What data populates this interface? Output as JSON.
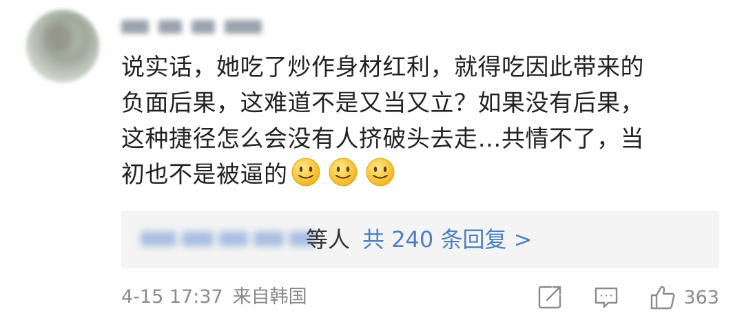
{
  "comment": {
    "text": "说实话，她吃了炒作身材红利，就得吃因此带来的\n负面后果，这难道不是又当又立？如果没有后果，\n这种捷径怎么会没有人挤破头去走…共情不了，当\n初也不是被逼的",
    "emoji_count": 3
  },
  "replies": {
    "suffix": "等人",
    "link": "共 240 条回复 >"
  },
  "footer": {
    "time": "4-15 17:37",
    "location": "来自韩国",
    "likes": "363"
  },
  "icons": {
    "share": "share-icon",
    "comment": "comment-icon",
    "like": "thumbs-up-icon"
  },
  "colors": {
    "text": "#222222",
    "muted": "#8a8a8a",
    "link": "#4a7fc3",
    "reply_bg": "#f4f4f4"
  }
}
